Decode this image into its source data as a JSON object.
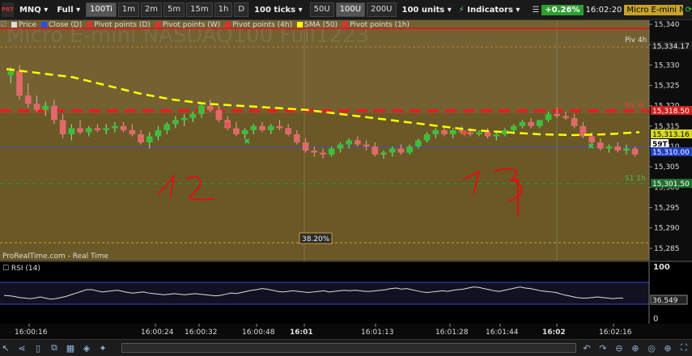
{
  "toolbar": {
    "logo": "PRT",
    "symbol": "MNQ",
    "view": "Full",
    "tick_buttons": [
      "100Ti",
      "1m",
      "2m",
      "5m",
      "15m",
      "1h",
      "D"
    ],
    "ticks_label": "100 ticks",
    "volume_buttons": [
      "50U",
      "100U",
      "200U"
    ],
    "units_label": "100 units",
    "indicators_label": "Indicators",
    "change_pct": "+0.26%",
    "time": "16:02:20",
    "instrument": "Micro E-mini NASDA"
  },
  "legend": [
    {
      "label": "Price",
      "color": "#dddddd"
    },
    {
      "label": "Close (D)",
      "color": "#2050ff"
    },
    {
      "label": "Pivot points (D)",
      "color": "#e03030"
    },
    {
      "label": "Pivot points (W)",
      "color": "#e03030"
    },
    {
      "label": "Pivot points (4h)",
      "color": "#e03030"
    },
    {
      "label": "SMA (50)",
      "color": "#ffff00"
    },
    {
      "label": "Pivot points (1h)",
      "color": "#e03030"
    }
  ],
  "watermark": "Micro E-mini NASDAQ100 Full1223",
  "source_label": "ProRealTime.com - Real Time",
  "rsi": {
    "label": "RSI (14)",
    "value_label": "36.549",
    "scale": [
      "100",
      "0"
    ],
    "values": [
      45,
      44,
      43,
      41,
      40,
      39,
      40,
      42,
      40,
      38,
      39,
      41,
      43,
      46,
      49,
      52,
      55,
      55,
      53,
      51,
      52,
      53,
      54,
      52,
      50,
      49,
      50,
      51,
      49,
      48,
      47,
      46,
      47,
      48,
      47,
      46,
      47,
      48,
      47,
      46,
      45,
      44,
      45,
      47,
      49,
      48,
      50,
      52,
      54,
      55,
      57,
      56,
      54,
      52,
      51,
      52,
      53,
      52,
      51,
      50,
      51,
      52,
      53,
      51,
      52,
      53,
      54,
      53,
      54,
      53,
      52,
      52,
      53,
      54,
      55,
      57,
      58,
      56,
      57,
      55,
      53,
      51,
      50,
      51,
      52,
      53,
      52,
      54,
      55,
      56,
      58,
      60,
      59,
      57,
      55,
      53,
      52,
      54,
      56,
      58,
      60,
      58,
      57,
      55,
      53,
      52,
      51,
      50,
      47,
      45,
      43,
      41,
      40,
      40,
      41,
      42,
      41,
      40,
      39,
      40,
      40
    ]
  },
  "pivot_labels": {
    "piv4h": "Piv 4h",
    "r1w": "R1 W",
    "s1_1h": "S1 1h",
    "fib": "38.20%"
  },
  "price_axis": {
    "ticks": [
      "15,340",
      "15,335",
      "15,330",
      "15,325",
      "15,320",
      "15,315",
      "15,310",
      "15,305",
      "15,300",
      "15,295",
      "15,290",
      "15,285"
    ],
    "tags": {
      "top": "15,334.17",
      "r1w": "15,318.50",
      "sma": "15,313.16",
      "current": "59T",
      "close_d": "15,310.00",
      "s1": "15,301.50"
    }
  },
  "time_axis": [
    "16:00:16",
    "16:00:24",
    "16:00:32",
    "16:00:48",
    "16:01",
    "16:01:13",
    "16:01:28",
    "16:01:44",
    "16:02",
    "16:02:16"
  ],
  "annotations": [
    "12",
    "13"
  ],
  "chart_data": {
    "type": "candlestick",
    "y_axis": [
      15282,
      15341
    ],
    "series": [
      {
        "name": "Price",
        "ohlc": [
          [
            15327.5,
            15329.5,
            15325.5,
            15328.5
          ],
          [
            15328.5,
            15330.0,
            15321.5,
            15322.5
          ],
          [
            15322.5,
            15325.5,
            15319.5,
            15320.5
          ],
          [
            15320.5,
            15322.5,
            15318.5,
            15319.0
          ],
          [
            15319.0,
            15321.0,
            15317.5,
            15320.0
          ],
          [
            15320.0,
            15321.5,
            15315.5,
            15316.5
          ],
          [
            15316.5,
            15318.0,
            15312.0,
            15313.0
          ],
          [
            15313.0,
            15315.5,
            15311.5,
            15314.5
          ],
          [
            15314.5,
            15316.5,
            15313.0,
            15313.5
          ],
          [
            15313.5,
            15315.0,
            15312.5,
            15314.5
          ],
          [
            15314.5,
            15315.5,
            15313.5,
            15314.0
          ],
          [
            15314.0,
            15315.5,
            15313.0,
            15314.5
          ],
          [
            15314.5,
            15316.0,
            15313.5,
            15315.0
          ],
          [
            15315.0,
            15316.0,
            15313.5,
            15314.0
          ],
          [
            15314.0,
            15315.5,
            15312.5,
            15313.0
          ],
          [
            15313.0,
            15314.0,
            15310.5,
            15311.0
          ],
          [
            15311.0,
            15313.5,
            15309.5,
            15312.5
          ],
          [
            15312.5,
            15315.0,
            15311.5,
            15314.0
          ],
          [
            15314.0,
            15316.0,
            15313.0,
            15315.5
          ],
          [
            15315.5,
            15317.5,
            15314.5,
            15316.5
          ],
          [
            15316.5,
            15318.0,
            15315.0,
            15317.0
          ],
          [
            15317.0,
            15318.5,
            15316.0,
            15318.0
          ],
          [
            15318.0,
            15320.5,
            15317.0,
            15320.0
          ],
          [
            15320.0,
            15321.5,
            15318.5,
            15319.0
          ],
          [
            15319.0,
            15320.0,
            15316.0,
            15316.5
          ],
          [
            15316.5,
            15317.5,
            15314.0,
            15314.5
          ],
          [
            15314.5,
            15316.0,
            15312.5,
            15313.0
          ],
          [
            15313.0,
            15314.5,
            15312.0,
            15314.0
          ],
          [
            15314.0,
            15315.5,
            15313.0,
            15315.0
          ],
          [
            15315.0,
            15316.0,
            15313.5,
            15314.0
          ],
          [
            15314.0,
            15315.5,
            15313.0,
            15315.0
          ],
          [
            15315.0,
            15316.5,
            15314.0,
            15314.5
          ],
          [
            15314.5,
            15315.5,
            15312.5,
            15313.0
          ],
          [
            15313.0,
            15314.0,
            15310.5,
            15311.0
          ],
          [
            15311.0,
            15312.0,
            15308.5,
            15309.0
          ],
          [
            15309.0,
            15310.0,
            15307.5,
            15308.5
          ],
          [
            15308.5,
            15309.5,
            15307.0,
            15308.0
          ],
          [
            15308.0,
            15310.0,
            15307.5,
            15309.5
          ],
          [
            15309.5,
            15311.0,
            15308.5,
            15310.5
          ],
          [
            15310.5,
            15312.0,
            15309.5,
            15311.5
          ],
          [
            15311.5,
            15312.5,
            15310.0,
            15310.5
          ],
          [
            15310.5,
            15311.5,
            15309.0,
            15310.0
          ],
          [
            15310.0,
            15311.0,
            15307.5,
            15308.0
          ],
          [
            15308.0,
            15309.0,
            15307.0,
            15308.5
          ],
          [
            15308.5,
            15310.0,
            15307.5,
            15309.5
          ],
          [
            15309.5,
            15310.5,
            15308.0,
            15308.5
          ],
          [
            15308.5,
            15310.5,
            15308.0,
            15310.0
          ],
          [
            15310.0,
            15312.0,
            15309.5,
            15311.5
          ],
          [
            15311.5,
            15313.5,
            15311.0,
            15313.0
          ],
          [
            15313.0,
            15314.5,
            15312.0,
            15314.0
          ],
          [
            15314.0,
            15315.0,
            15312.5,
            15313.0
          ],
          [
            15313.0,
            15314.5,
            15312.0,
            15314.0
          ],
          [
            15314.0,
            15315.0,
            15313.0,
            15313.5
          ],
          [
            15313.5,
            15314.5,
            15312.5,
            15313.0
          ],
          [
            15313.0,
            15314.0,
            15312.5,
            15313.5
          ],
          [
            15313.5,
            15314.5,
            15312.0,
            15312.5
          ],
          [
            15312.5,
            15313.5,
            15311.5,
            15313.0
          ],
          [
            15313.0,
            15314.5,
            15312.5,
            15314.0
          ],
          [
            15314.0,
            15315.5,
            15313.0,
            15315.0
          ],
          [
            15315.0,
            15316.5,
            15314.5,
            15316.0
          ],
          [
            15316.0,
            15317.0,
            15314.5,
            15315.0
          ],
          [
            15315.0,
            15316.5,
            15314.5,
            15316.5
          ],
          [
            15316.5,
            15318.5,
            15316.0,
            15318.0
          ],
          [
            15318.0,
            15319.5,
            15317.0,
            15317.5
          ],
          [
            15317.5,
            15318.5,
            15316.5,
            15317.0
          ],
          [
            15317.0,
            15318.0,
            15314.5,
            15315.0
          ],
          [
            15315.0,
            15316.0,
            15312.0,
            15312.5
          ],
          [
            15312.5,
            15313.5,
            15310.5,
            15311.0
          ],
          [
            15311.0,
            15312.0,
            15309.0,
            15309.5
          ],
          [
            15309.5,
            15310.5,
            15308.5,
            15310.0
          ],
          [
            15310.0,
            15311.0,
            15308.5,
            15309.0
          ],
          [
            15309.0,
            15310.5,
            15308.0,
            15309.5
          ],
          [
            15309.5,
            15310.0,
            15307.5,
            15308.0
          ]
        ]
      },
      {
        "name": "SMA (50)",
        "values": [
          15329.0,
          15328.0,
          15327.0,
          15325.0,
          15323.0,
          15321.5,
          15320.5,
          15320.0,
          15319.5,
          15319.0,
          15318.0,
          15317.0,
          15316.0,
          15315.0,
          15314.0,
          15313.5,
          15313.0,
          15312.8,
          15313.0,
          15313.5
        ]
      }
    ]
  }
}
